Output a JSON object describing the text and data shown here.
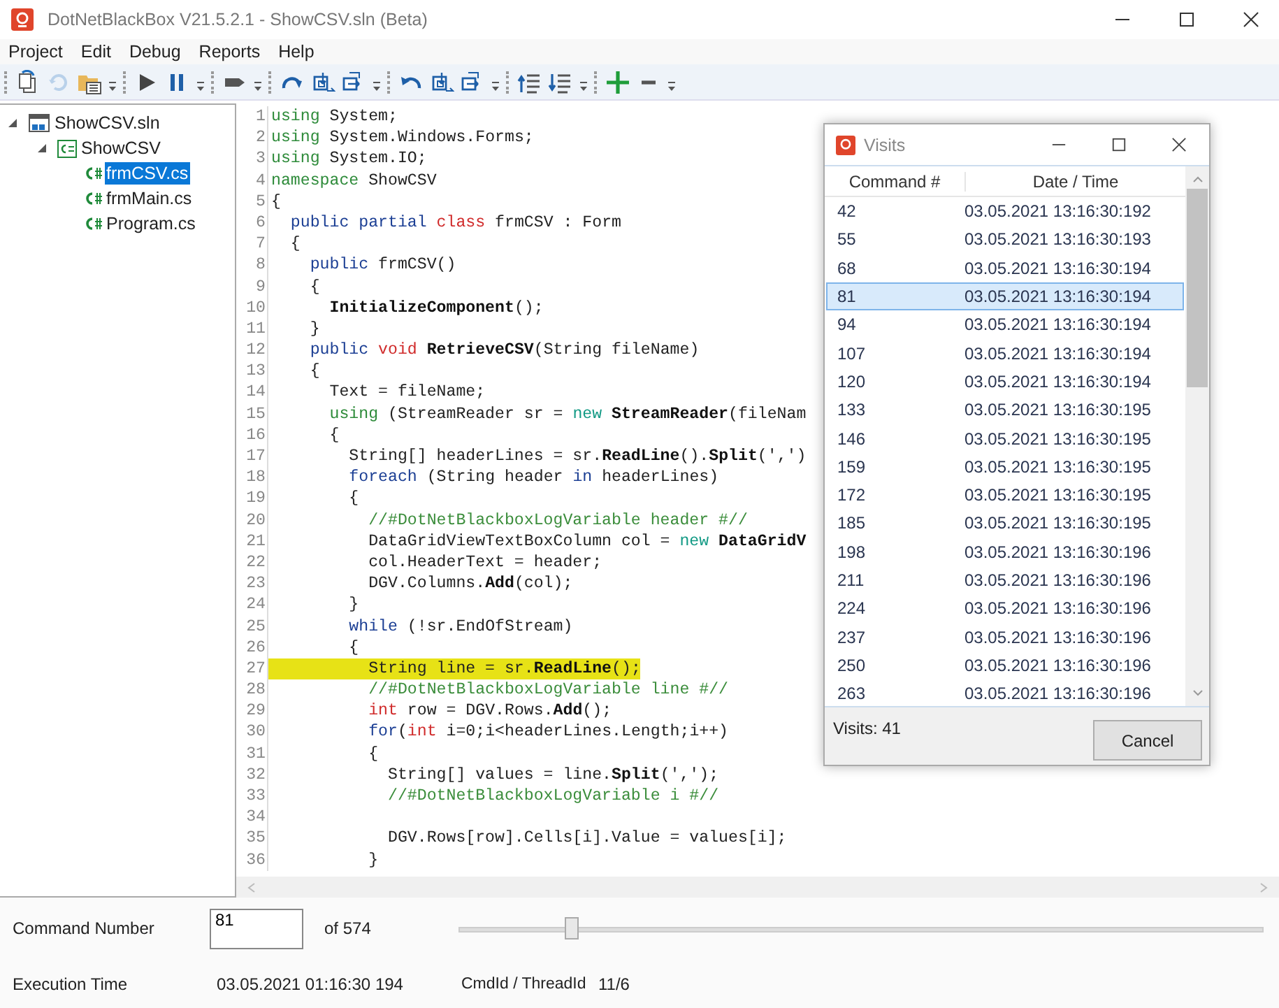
{
  "window": {
    "title": "DotNetBlackBox V21.5.2.1 - ShowCSV.sln (Beta)"
  },
  "menu": [
    "Project",
    "Edit",
    "Debug",
    "Reports",
    "Help"
  ],
  "toolbar": [
    [
      {
        "kind": "open-solution",
        "disabled": false
      },
      {
        "kind": "refresh",
        "disabled": true
      },
      {
        "kind": "folder-list",
        "disabled": false
      },
      {
        "kind": "dropdown",
        "disabled": false
      }
    ],
    [
      {
        "kind": "play",
        "disabled": false
      },
      {
        "kind": "pause",
        "disabled": false
      },
      {
        "kind": "dropdown",
        "disabled": false
      }
    ],
    [
      {
        "kind": "tag",
        "disabled": false
      },
      {
        "kind": "dropdown",
        "disabled": false
      }
    ],
    [
      {
        "kind": "step-over",
        "disabled": false
      },
      {
        "kind": "step-into",
        "disabled": false
      },
      {
        "kind": "step-out",
        "disabled": false
      },
      {
        "kind": "dropdown",
        "disabled": false
      }
    ],
    [
      {
        "kind": "undo",
        "disabled": false
      },
      {
        "kind": "frame-in",
        "disabled": false
      },
      {
        "kind": "frame-out",
        "disabled": false
      },
      {
        "kind": "dropdown",
        "disabled": false
      }
    ],
    [
      {
        "kind": "indent-up",
        "disabled": false
      },
      {
        "kind": "indent-down",
        "disabled": false
      },
      {
        "kind": "dropdown",
        "disabled": false
      }
    ],
    [
      {
        "kind": "add",
        "disabled": false
      },
      {
        "kind": "remove",
        "disabled": false
      },
      {
        "kind": "dropdown",
        "disabled": false
      }
    ]
  ],
  "solution_tree": [
    {
      "label": "ShowCSV.sln",
      "kind": "solution",
      "expanded": true,
      "selected": false,
      "children": [
        {
          "label": "ShowCSV",
          "kind": "project",
          "expanded": true,
          "selected": false,
          "children": [
            {
              "label": "frmCSV.cs",
              "kind": "file",
              "selected": true
            },
            {
              "label": "frmMain.cs",
              "kind": "file",
              "selected": false
            },
            {
              "label": "Program.cs",
              "kind": "file",
              "selected": false
            }
          ]
        }
      ]
    }
  ],
  "editor": {
    "lines": [
      {
        "number": "1",
        "tokens": [
          {
            "kind": "directive",
            "text": "using"
          },
          {
            "kind": "plain",
            "text": " System;"
          }
        ]
      },
      {
        "number": "2",
        "tokens": [
          {
            "kind": "directive",
            "text": "using"
          },
          {
            "kind": "plain",
            "text": " System.Windows.Forms;"
          }
        ]
      },
      {
        "number": "3",
        "tokens": [
          {
            "kind": "directive",
            "text": "using"
          },
          {
            "kind": "plain",
            "text": " System.IO;"
          }
        ]
      },
      {
        "number": "4",
        "tokens": [
          {
            "kind": "directive",
            "text": "namespace"
          },
          {
            "kind": "plain",
            "text": " ShowCSV"
          }
        ]
      },
      {
        "number": "5",
        "tokens": [
          {
            "kind": "plain",
            "text": "{"
          }
        ]
      },
      {
        "number": "6",
        "tokens": [
          {
            "kind": "keyword",
            "text": "  public partial"
          },
          {
            "kind": "type",
            "text": " class"
          },
          {
            "kind": "plain",
            "text": " frmCSV : Form"
          }
        ]
      },
      {
        "number": "7",
        "tokens": [
          {
            "kind": "plain",
            "text": "  {"
          }
        ]
      },
      {
        "number": "8",
        "tokens": [
          {
            "kind": "keyword",
            "text": "    public"
          },
          {
            "kind": "plain",
            "text": " frmCSV()"
          }
        ]
      },
      {
        "number": "9",
        "tokens": [
          {
            "kind": "plain",
            "text": "    {"
          }
        ]
      },
      {
        "number": "10",
        "tokens": [
          {
            "kind": "member",
            "text": "      InitializeComponent"
          },
          {
            "kind": "plain",
            "text": "();"
          }
        ]
      },
      {
        "number": "11",
        "tokens": [
          {
            "kind": "plain",
            "text": "    }"
          }
        ]
      },
      {
        "number": "12",
        "tokens": [
          {
            "kind": "keyword",
            "text": "    public"
          },
          {
            "kind": "type",
            "text": " void"
          },
          {
            "kind": "member",
            "text": " RetrieveCSV"
          },
          {
            "kind": "plain",
            "text": "(String fileName)"
          }
        ]
      },
      {
        "number": "13",
        "tokens": [
          {
            "kind": "plain",
            "text": "    {"
          }
        ]
      },
      {
        "number": "14",
        "tokens": [
          {
            "kind": "plain",
            "text": "      Text = fileName;"
          }
        ]
      },
      {
        "number": "15",
        "tokens": [
          {
            "kind": "directive",
            "text": "      using"
          },
          {
            "kind": "plain",
            "text": " (StreamReader sr = "
          },
          {
            "kind": "new",
            "text": "new"
          },
          {
            "kind": "member",
            "text": " StreamReader"
          },
          {
            "kind": "plain",
            "text": "(fileNam"
          }
        ]
      },
      {
        "number": "16",
        "tokens": [
          {
            "kind": "plain",
            "text": "      {"
          }
        ]
      },
      {
        "number": "17",
        "tokens": [
          {
            "kind": "plain",
            "text": "        String[] headerLines = sr."
          },
          {
            "kind": "member",
            "text": "ReadLine"
          },
          {
            "kind": "plain",
            "text": "()."
          },
          {
            "kind": "member",
            "text": "Split"
          },
          {
            "kind": "plain",
            "text": "(',')"
          }
        ]
      },
      {
        "number": "18",
        "tokens": [
          {
            "kind": "keyword",
            "text": "        foreach"
          },
          {
            "kind": "plain",
            "text": " (String header "
          },
          {
            "kind": "keyword",
            "text": "in"
          },
          {
            "kind": "plain",
            "text": " headerLines)"
          }
        ]
      },
      {
        "number": "19",
        "tokens": [
          {
            "kind": "plain",
            "text": "        {"
          }
        ]
      },
      {
        "number": "20",
        "tokens": [
          {
            "kind": "comment",
            "text": "          //#DotNetBlackboxLogVariable header #//"
          }
        ]
      },
      {
        "number": "21",
        "tokens": [
          {
            "kind": "plain",
            "text": "          DataGridViewTextBoxColumn col = "
          },
          {
            "kind": "new",
            "text": "new"
          },
          {
            "kind": "member",
            "text": " DataGridV"
          }
        ]
      },
      {
        "number": "22",
        "tokens": [
          {
            "kind": "plain",
            "text": "          col.HeaderText = header;"
          }
        ]
      },
      {
        "number": "23",
        "tokens": [
          {
            "kind": "plain",
            "text": "          DGV.Columns."
          },
          {
            "kind": "member",
            "text": "Add"
          },
          {
            "kind": "plain",
            "text": "(col);"
          }
        ]
      },
      {
        "number": "24",
        "tokens": [
          {
            "kind": "plain",
            "text": "        }"
          }
        ]
      },
      {
        "number": "25",
        "tokens": [
          {
            "kind": "keyword",
            "text": "        while"
          },
          {
            "kind": "plain",
            "text": " (!sr.EndOfStream)"
          }
        ]
      },
      {
        "number": "26",
        "tokens": [
          {
            "kind": "plain",
            "text": "        {"
          }
        ]
      },
      {
        "number": "27",
        "highlighted": true,
        "tokens": [
          {
            "kind": "plain",
            "text": "          String line = sr."
          },
          {
            "kind": "member",
            "text": "ReadLine"
          },
          {
            "kind": "plain",
            "text": "();"
          }
        ]
      },
      {
        "number": "28",
        "tokens": [
          {
            "kind": "comment",
            "text": "          //#DotNetBlackboxLogVariable line #//"
          }
        ]
      },
      {
        "number": "29",
        "tokens": [
          {
            "kind": "type",
            "text": "          int"
          },
          {
            "kind": "plain",
            "text": " row = DGV.Rows."
          },
          {
            "kind": "member",
            "text": "Add"
          },
          {
            "kind": "plain",
            "text": "();"
          }
        ]
      },
      {
        "number": "30",
        "tokens": [
          {
            "kind": "keyword",
            "text": "          for"
          },
          {
            "kind": "plain",
            "text": "("
          },
          {
            "kind": "type",
            "text": "int"
          },
          {
            "kind": "plain",
            "text": " i=0;i<headerLines.Length;i++)"
          }
        ]
      },
      {
        "number": "31",
        "tokens": [
          {
            "kind": "plain",
            "text": "          {"
          }
        ]
      },
      {
        "number": "32",
        "tokens": [
          {
            "kind": "plain",
            "text": "            String[] values = line."
          },
          {
            "kind": "member",
            "text": "Split"
          },
          {
            "kind": "plain",
            "text": "(',');"
          }
        ]
      },
      {
        "number": "33",
        "tokens": [
          {
            "kind": "comment",
            "text": "            //#DotNetBlackboxLogVariable i #//"
          }
        ]
      },
      {
        "number": "34"
      },
      {
        "number": "35",
        "tokens": [
          {
            "kind": "plain",
            "text": "            DGV.Rows[row].Cells[i].Value = values[i];"
          }
        ]
      },
      {
        "number": "36",
        "tokens": [
          {
            "kind": "plain",
            "text": "          }"
          }
        ]
      }
    ]
  },
  "visits_dialog": {
    "title": "Visits",
    "columns": [
      "Command #",
      "Date / Time"
    ],
    "rows": [
      {
        "command": "42",
        "time": "03.05.2021 13:16:30:192",
        "selected": false
      },
      {
        "command": "55",
        "time": "03.05.2021 13:16:30:193",
        "selected": false
      },
      {
        "command": "68",
        "time": "03.05.2021 13:16:30:194",
        "selected": false
      },
      {
        "command": "81",
        "time": "03.05.2021 13:16:30:194",
        "selected": true
      },
      {
        "command": "94",
        "time": "03.05.2021 13:16:30:194",
        "selected": false
      },
      {
        "command": "107",
        "time": "03.05.2021 13:16:30:194",
        "selected": false
      },
      {
        "command": "120",
        "time": "03.05.2021 13:16:30:194",
        "selected": false
      },
      {
        "command": "133",
        "time": "03.05.2021 13:16:30:195",
        "selected": false
      },
      {
        "command": "146",
        "time": "03.05.2021 13:16:30:195",
        "selected": false
      },
      {
        "command": "159",
        "time": "03.05.2021 13:16:30:195",
        "selected": false
      },
      {
        "command": "172",
        "time": "03.05.2021 13:16:30:195",
        "selected": false
      },
      {
        "command": "185",
        "time": "03.05.2021 13:16:30:195",
        "selected": false
      },
      {
        "command": "198",
        "time": "03.05.2021 13:16:30:196",
        "selected": false
      },
      {
        "command": "211",
        "time": "03.05.2021 13:16:30:196",
        "selected": false
      },
      {
        "command": "224",
        "time": "03.05.2021 13:16:30:196",
        "selected": false
      },
      {
        "command": "237",
        "time": "03.05.2021 13:16:30:196",
        "selected": false
      },
      {
        "command": "250",
        "time": "03.05.2021 13:16:30:196",
        "selected": false
      },
      {
        "command": "263",
        "time": "03.05.2021 13:16:30:196",
        "selected": false
      }
    ],
    "count": "Visits: 41",
    "cancel": "Cancel"
  },
  "status": {
    "command_label": "Command Number",
    "command_value": "81",
    "command_total": "of 574",
    "slider": {
      "level": 0.14
    },
    "time_label": "Execution Time",
    "time_value": "03.05.2021 01:16:30 194",
    "thread_label": "CmdId / ThreadId",
    "thread_value": "11/6"
  }
}
